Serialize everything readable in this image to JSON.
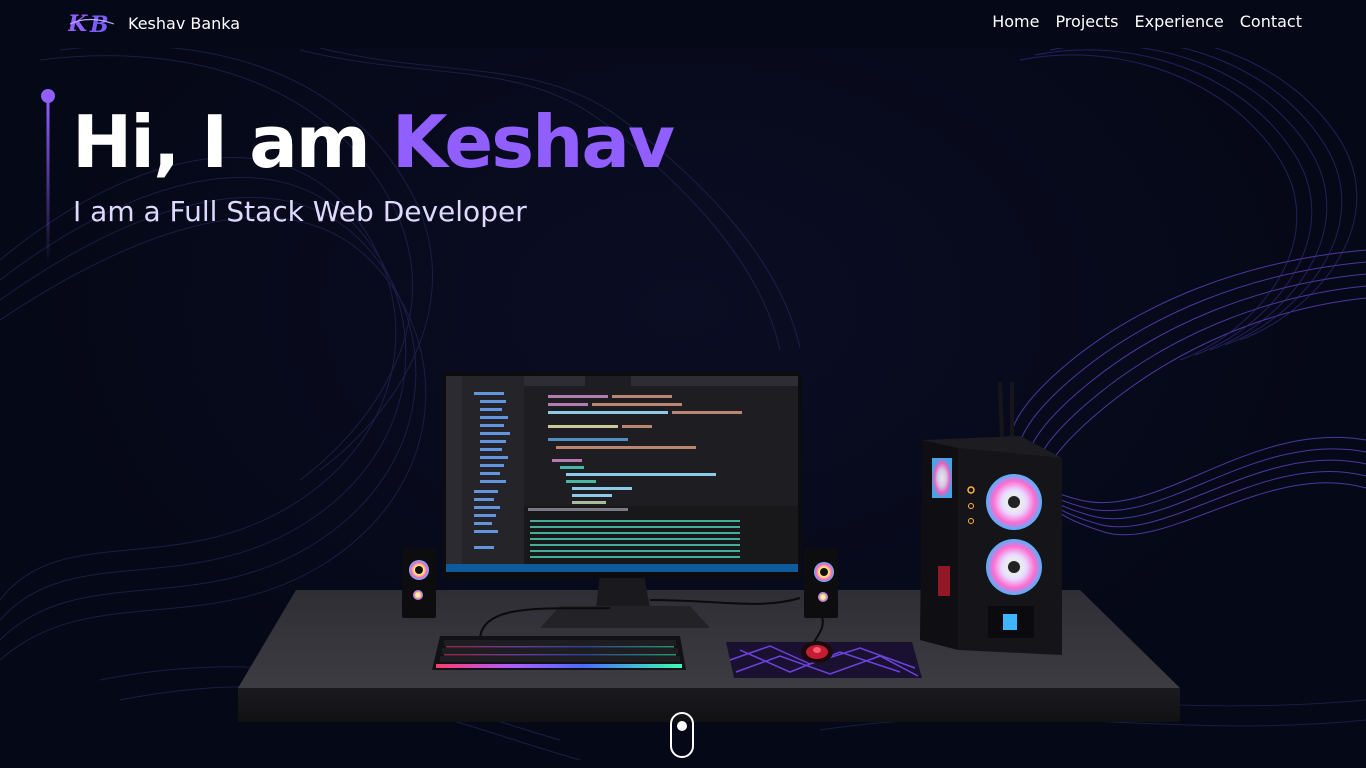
{
  "colors": {
    "background": "#050816",
    "accent": "#915eff",
    "text": "#ffffff",
    "subtitle": "#dfd9ff"
  },
  "brand": {
    "logo_icon": "kb-logo-icon",
    "name": "Keshav Banka"
  },
  "nav": {
    "items": [
      {
        "label": "Home"
      },
      {
        "label": "Projects"
      },
      {
        "label": "Experience"
      },
      {
        "label": "Contact"
      }
    ]
  },
  "hero": {
    "greeting": "Hi, I am ",
    "name": "Keshav",
    "subtitle": "I am a Full Stack Web Developer"
  },
  "scene": {
    "description_icon": "desktop-setup-3d-icon"
  },
  "scroll": {
    "icon": "scroll-mouse-icon"
  }
}
